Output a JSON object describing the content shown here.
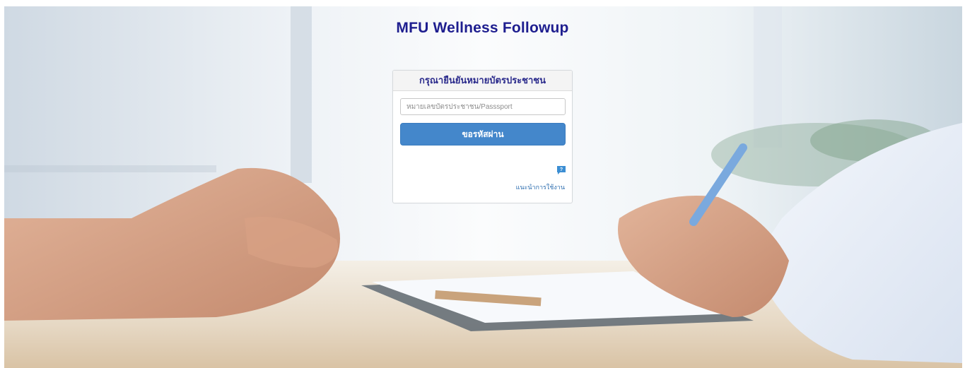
{
  "page": {
    "title": "MFU Wellness Followup"
  },
  "card": {
    "header": "กรุณายืนยันหมายบัตรประชาชน",
    "id_input": {
      "value": "",
      "placeholder": "หมายเลขบัตรประชาชน/Passsport"
    },
    "request_button_label": "ขอรหัสผ่าน",
    "help_icon": "help-speech-bubble-icon",
    "help_link_label": "แนะนำการใช้งาน"
  },
  "colors": {
    "title": "#1e1e8f",
    "button": "#4487cb",
    "link": "#2f6fb0"
  }
}
